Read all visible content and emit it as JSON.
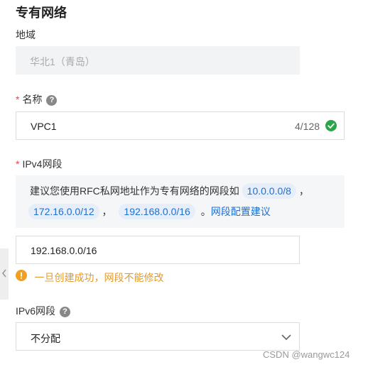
{
  "section": {
    "title": "专有网络"
  },
  "region": {
    "label": "地域",
    "value": "华北1（青岛）"
  },
  "name": {
    "required_mark": "*",
    "label": "名称",
    "value": "VPC1",
    "counter": "4/128"
  },
  "ipv4": {
    "required_mark": "*",
    "label": "IPv4网段",
    "tip_text": "建议您使用RFC私网地址作为专有网络的网段如",
    "suggestions": [
      "10.0.0.0/8",
      "172.16.0.0/12",
      "192.168.0.0/16"
    ],
    "separator": "，",
    "end_mark": "。",
    "link_text": "网段配置建议",
    "value": "192.168.0.0/16",
    "warning": "一旦创建成功，网段不能修改"
  },
  "ipv6": {
    "label": "IPv6网段",
    "selected": "不分配"
  },
  "watermark": "CSDN @wangwc124",
  "colors": {
    "accent": "#1f6fd1",
    "success": "#2aa549",
    "warning": "#f0a020",
    "required": "#e5484d"
  }
}
